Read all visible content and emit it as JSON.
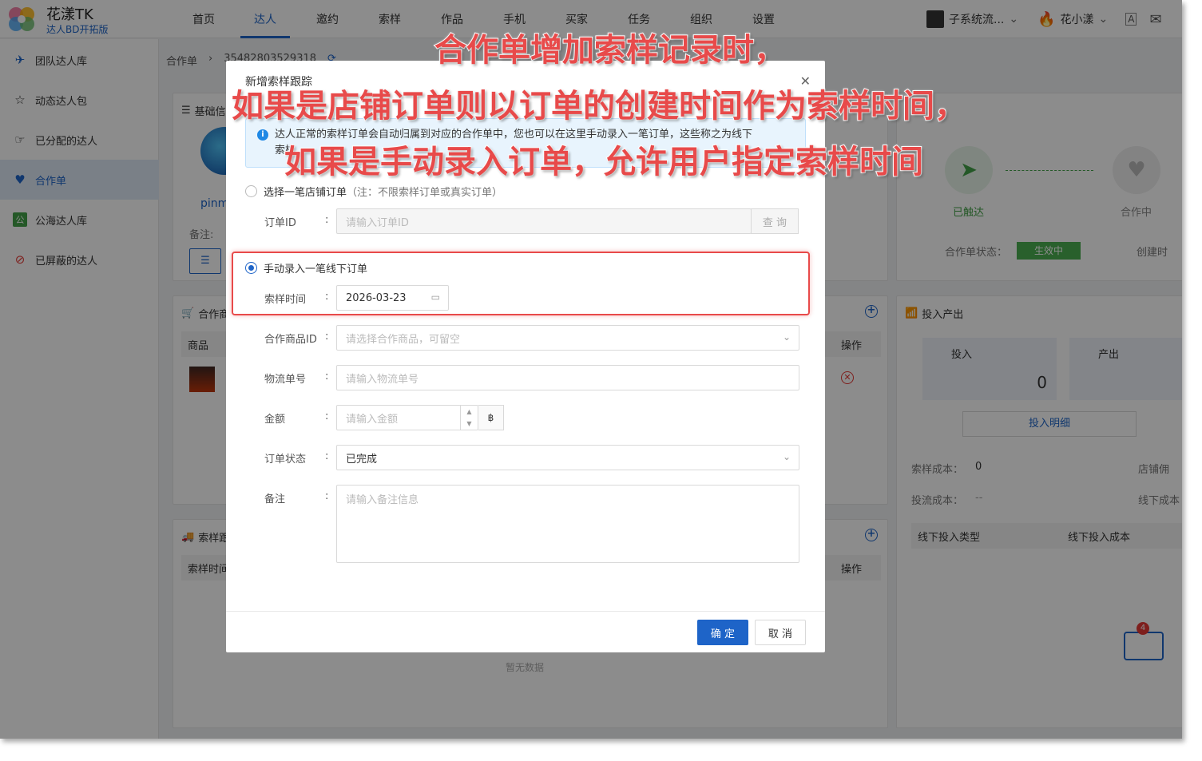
{
  "brand": {
    "name": "花漾TK",
    "subtitle": "达人BD开拓版"
  },
  "nav": {
    "items": [
      "首页",
      "达人",
      "邀约",
      "索样",
      "作品",
      "手机",
      "买家",
      "任务",
      "组织",
      "设置"
    ],
    "active_index": 1
  },
  "account": {
    "team": "子系统流...",
    "user": "花小漾"
  },
  "sidebar": {
    "items": [
      {
        "label": "团队达人库",
        "icon": "team-icon"
      },
      {
        "label": "动态达人包",
        "icon": "star-icon"
      },
      {
        "label": "已分配的达人",
        "icon": "assign-icon"
      },
      {
        "label": "合作单",
        "icon": "handshake-icon"
      },
      {
        "label": "公海达人库",
        "icon": "public-icon"
      },
      {
        "label": "已屏蔽的达人",
        "icon": "block-icon"
      }
    ],
    "active_index": 3
  },
  "breadcrumb": {
    "root": "合作单",
    "id": "35482803529318"
  },
  "background": {
    "basic_info": "基础信",
    "name_partial": "pinm",
    "remark_label": "备注:",
    "coop_goods": "合作商",
    "goods_col": "商品",
    "op_col": "操作",
    "sample_track": "索样跟",
    "sample_time_col": "索样时间",
    "empty": "暂无数据",
    "status_touched": "已触达",
    "status_coop": "合作中",
    "coop_status_label": "合作单状态：",
    "coop_status_value": "生效中",
    "create_partial": "创建时",
    "io_title": "投入产出",
    "input_label": "投入",
    "output_label": "产出",
    "input_value": "0",
    "input_detail": "投入明细",
    "sample_cost_label": "索样成本：",
    "sample_cost_value": "0",
    "shop_partial": "店铺佣",
    "flow_cost_label": "投流成本：",
    "flow_cost_value": "--",
    "offline_partial": "线下成本",
    "offline_type_col": "线下投入类型",
    "offline_cost_col": "线下投入成本",
    "badge_count": "4"
  },
  "modal": {
    "title": "新增索样跟踪",
    "info_line1": "达人正常的索样订单会自动归属到对应的合作单中，您也可以在这里手动录入一笔订单，这些称之为线下",
    "info_line2": "索样",
    "option_shop": "选择一笔店铺订单",
    "option_shop_note": "（注：不限索样订单或真实订单）",
    "order_id_label": "订单ID",
    "order_id_placeholder": "请输入订单ID",
    "query_label": "查 询",
    "option_manual": "手动录入一笔线下订单",
    "sample_time_label": "索样时间",
    "sample_time_value": "2026-03-23",
    "goods_id_label": "合作商品ID",
    "goods_id_placeholder": "请选择合作商品，可留空",
    "tracking_label": "物流单号",
    "tracking_placeholder": "请输入物流单号",
    "amount_label": "金额",
    "amount_placeholder": "请输入金额",
    "currency": "฿",
    "order_status_label": "订单状态",
    "order_status_value": "已完成",
    "remark_label": "备注",
    "remark_placeholder": "请输入备注信息",
    "ok": "确 定",
    "cancel": "取 消",
    "colon": ":"
  },
  "annotations": {
    "line1": "合作单增加索样记录时，",
    "line2": "如果是店铺订单则以订单的创建时间作为索样时间，",
    "line3": "如果是手动录入订单，允许用户指定索样时间"
  },
  "colors": {
    "accent": "#1e64c8",
    "annotation": "#e84a4a",
    "status_active": "#4caf50"
  }
}
